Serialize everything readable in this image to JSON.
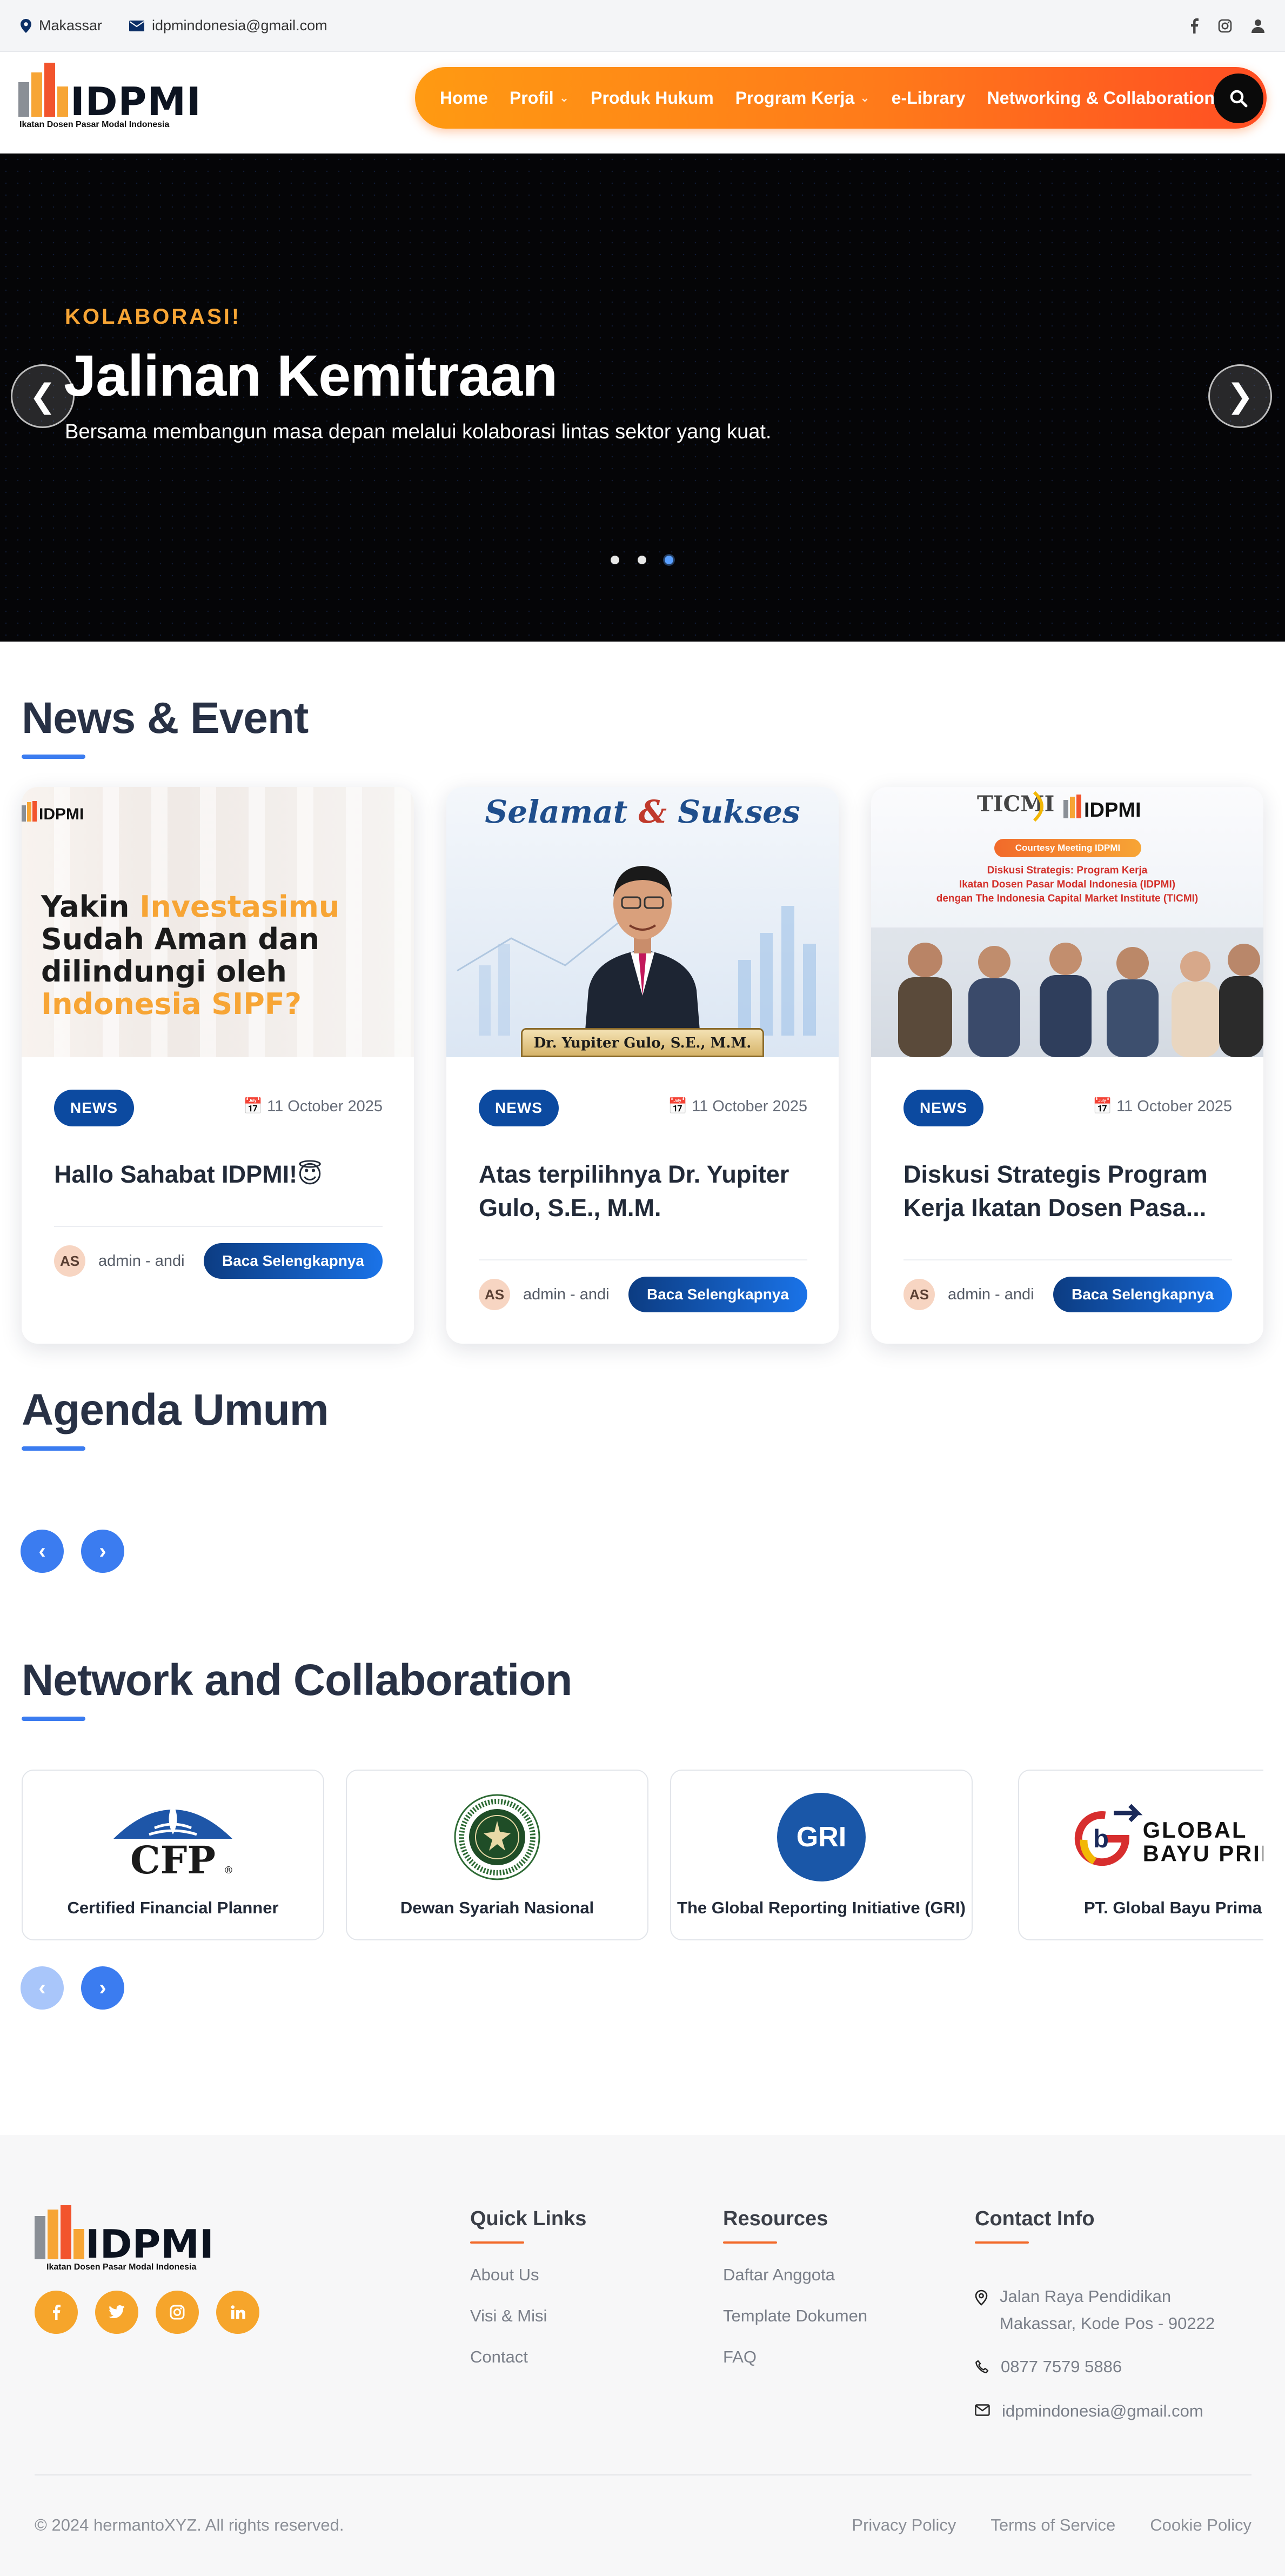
{
  "topbar": {
    "location": "Makassar",
    "email": "idpmindonesia@gmail.com",
    "social_icons": [
      "facebook-icon",
      "instagram-icon",
      "user-icon"
    ]
  },
  "brand": {
    "name": "IDPMI",
    "tagline": "Ikatan Dosen Pasar Modal Indonesia",
    "bar_colors": [
      "#8a8f96",
      "#f7a535",
      "#f2542d",
      "#f7a535"
    ]
  },
  "nav": {
    "items": [
      {
        "label": "Home",
        "dropdown": false
      },
      {
        "label": "Profil",
        "dropdown": true
      },
      {
        "label": "Produk Hukum",
        "dropdown": false
      },
      {
        "label": "Program Kerja",
        "dropdown": true
      },
      {
        "label": "e-Library",
        "dropdown": false
      },
      {
        "label": "Networking & Collaboration",
        "dropdown": false
      }
    ],
    "gradient": [
      "#ff9a12",
      "#ff4e23"
    ]
  },
  "hero": {
    "kicker": "KOLABORASI!",
    "title": "Jalinan Kemitraan",
    "subtitle": "Bersama membangun masa depan melalui kolaborasi lintas sektor yang kuat.",
    "prev": "❮",
    "next": "❯",
    "slide_count": 3,
    "active_slide": 3
  },
  "news": {
    "title": "News & Event",
    "cards": [
      {
        "badge": "NEWS",
        "date": "📅 11 October 2025",
        "title": "Hallo Sahabat IDPMI!😇",
        "avatar": "AS",
        "author": "admin - andi",
        "cta": "Baca Selengkapnya",
        "thumb": {
          "brand": "IDPMI",
          "line1a": "Yakin ",
          "line1b": "Investasimu",
          "line2": "Sudah Aman dan",
          "line3": "dilindungi oleh",
          "line4": "Indonesia SIPF?"
        }
      },
      {
        "badge": "NEWS",
        "date": "📅 11 October 2025",
        "title": "Atas terpilihnya Dr. Yupiter Gulo, S.E., M.M.",
        "avatar": "AS",
        "author": "admin - andi",
        "cta": "Baca Selengkapnya",
        "thumb": {
          "headline_a": "Selamat",
          "headline_amp": " & ",
          "headline_b": "Sukses",
          "nameplate": "Dr. Yupiter Gulo, S.E., M.M."
        }
      },
      {
        "badge": "NEWS",
        "date": "📅 11 October 2025",
        "title": "Diskusi Strategis Program Kerja Ikatan Dosen Pasa...",
        "avatar": "AS",
        "author": "admin - andi",
        "cta": "Baca Selengkapnya",
        "thumb": {
          "logo_left": "TICMI",
          "logo_right": "IDPMI",
          "pill": "Courtesy Meeting IDPMI",
          "line1": "Diskusi Strategis: Program Kerja",
          "line2": "Ikatan Dosen Pasar Modal Indonesia (IDPMI)",
          "line3": "dengan The Indonesia Capital Market Institute (TICMI)"
        }
      }
    ]
  },
  "agenda": {
    "title": "Agenda Umum",
    "prev": "‹",
    "next": "›"
  },
  "network": {
    "title": "Network and Collaboration",
    "prev": "‹",
    "next": "›",
    "partners": [
      {
        "name": "Certified Financial Planner",
        "logo_text": "CFP",
        "logo_mark": "®"
      },
      {
        "name": "Dewan Syariah Nasional",
        "logo_text": ""
      },
      {
        "name": "The Global Reporting Initiative (GRI)",
        "logo_text": "GRI"
      },
      {
        "name": "PT. Global Bayu Prima",
        "logo_text_1": "GLOBAL",
        "logo_text_2": "BAYU PRIMA"
      }
    ]
  },
  "footer": {
    "brand": "IDPMI",
    "tagline": "Ikatan Dosen Pasar Modal Indonesia",
    "social_icons": [
      "facebook-icon",
      "twitter-icon",
      "instagram-icon",
      "linkedin-icon"
    ],
    "quick_links": {
      "title": "Quick Links",
      "items": [
        "About Us",
        "Visi & Misi",
        "Contact"
      ]
    },
    "resources": {
      "title": "Resources",
      "items": [
        "Daftar Anggota",
        "Template Dokumen",
        "FAQ"
      ]
    },
    "contact": {
      "title": "Contact Info",
      "address_1": "Jalan Raya Pendidikan",
      "address_2": "Makassar, Kode Pos - 90222",
      "phone": "0877 7579 5886",
      "email": "idpmindonesia@gmail.com"
    },
    "copyright": "© 2024 hermantoXYZ. All rights reserved.",
    "legal_links": [
      "Privacy Policy",
      "Terms of Service",
      "Cookie Policy"
    ]
  }
}
